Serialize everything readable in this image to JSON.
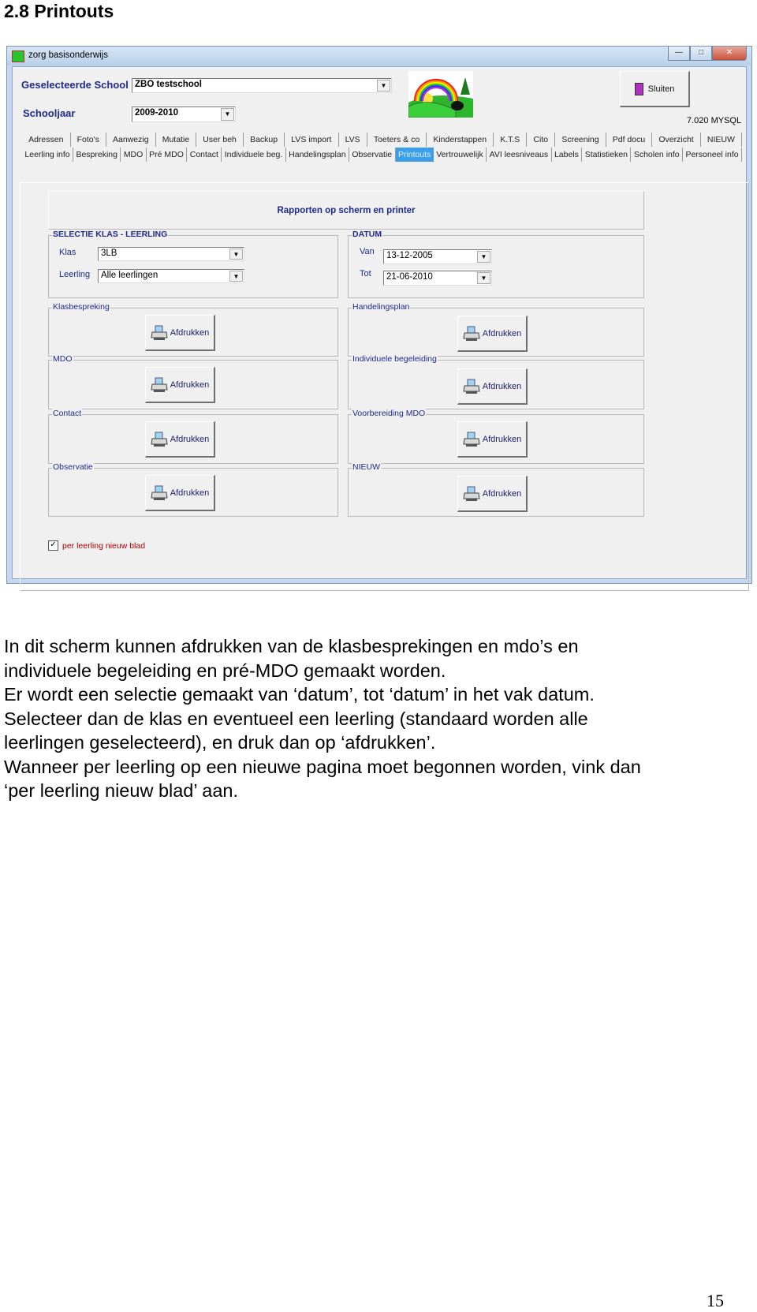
{
  "doc": {
    "title": "2.8 Printouts",
    "paragraph_lines": [
      "In dit scherm kunnen afdrukken van de klasbesprekingen en mdo’s en",
      "individuele begeleiding en pré-MDO gemaakt worden.",
      "Er wordt een selectie gemaakt van ‘datum’, tot ‘datum’ in het vak datum.",
      "Selecteer dan de klas en eventueel een leerling (standaard worden alle",
      "leerlingen geselecteerd), en druk dan op ‘afdrukken’.",
      "Wanneer per leerling op een nieuwe pagina moet begonnen worden, vink dan",
      "‘per leerling nieuw blad’ aan."
    ],
    "page_number": "15"
  },
  "window": {
    "title": "zorg basisonderwijs",
    "school_label": "Geselecteerde School :",
    "school_value": "ZBO testschool",
    "year_label": "Schooljaar",
    "year_value": "2009-2010",
    "close_button": "Sluiten",
    "version": "7.020 MYSQL",
    "tabs_row1": [
      "Adressen",
      "Foto's",
      "Aanwezig",
      "Mutatie",
      "User beh",
      "Backup",
      "LVS import",
      "LVS",
      "Toeters & co",
      "Kinderstappen",
      "K.T.S",
      "Cito",
      "Screening",
      "Pdf docu",
      "Overzicht",
      "NIEUW"
    ],
    "tabs_row2": [
      "Leerling info",
      "Bespreking",
      "MDO",
      "Pré MDO",
      "Contact",
      "Individuele beg.",
      "Handelingsplan",
      "Observatie",
      "Printouts",
      "Vertrouwelijk",
      "AVI leesniveaus",
      "Labels",
      "Statistieken",
      "Scholen info",
      "Personeel info"
    ],
    "selected_tab": "Printouts",
    "header": "Rapporten op scherm en printer",
    "selectie": {
      "title": "SELECTIE KLAS - LEERLING",
      "klas_label": "Klas",
      "klas_value": "3LB",
      "leerling_label": "Leerling",
      "leerling_value": "Alle leerlingen"
    },
    "datum": {
      "title": "DATUM",
      "van_label": "Van",
      "van_value": "13-12-2005",
      "tot_label": "Tot",
      "tot_value": "21-06-2010"
    },
    "print_label": "Afdrukken",
    "sections_left": [
      "Klasbespreking",
      "MDO",
      "Contact",
      "Observatie"
    ],
    "sections_right": [
      "Handelingsplan",
      "Individuele begeleiding",
      "Voorbereiding MDO",
      "NIEUW"
    ],
    "checkbox": {
      "label": "per leerling nieuw blad",
      "checked": true
    },
    "colors": {
      "label_blue": "#1f2a8a",
      "tab_selected": "#3d9fea",
      "checkbox_label": "#b00000"
    }
  }
}
